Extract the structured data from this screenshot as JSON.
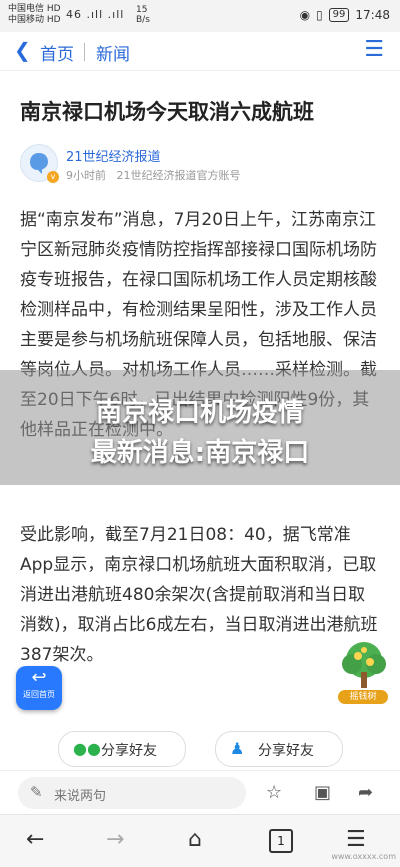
{
  "status_bar": {
    "carrier1": "中国电信 HD",
    "carrier2": "中国移动 HD",
    "signal": "46 .ıll .ıll",
    "speed_value": "15",
    "speed_unit": "B/s",
    "battery": "99",
    "time": "17:48"
  },
  "nav": {
    "home_label": "首页",
    "section_label": "新闻"
  },
  "article": {
    "title": "南京禄口机场今天取消六成航班",
    "source": "21世纪经济报道",
    "time_ago": "9小时前",
    "account": "21世纪经济报道官方账号",
    "paragraphs": [
      "据“南京发布”消息，7月20日上午，江苏南京江宁区新冠肺炎疫情防控指挥部接禄口国际机场防疫专班报告，在禄口国际机场工作人员定期核酸检测样品中，有检测结果呈阳性，涉及工作人员主要是参与机场航班保障人员，包括地服、保洁等岗位人员。对机场工作人员……采样检测。截至20日下午6时，已出结果中检测阳性9份，其他样品正在检测中。",
      "受此影响，截至7月21日08：40，据飞常准App显示，南京禄口机场航班大面积取消，已取消进出港航班480余架次(含提前取消和当日取消数)，取消占比6成左右，当日取消进出港航班387架次。"
    ]
  },
  "banner": {
    "line1": "南京禄口机场疫情",
    "line2": "最新消息:南京禄口"
  },
  "floating": {
    "return_label": "返回首页",
    "tree_label": "摇钱树"
  },
  "share": {
    "wechat": "分享好友",
    "qq": "分享好友"
  },
  "comment": {
    "placeholder": "来说两句"
  },
  "system_nav": {
    "tab_count": "1"
  },
  "watermark": "www.oxxxx.com",
  "colors": {
    "accent": "#2b6ad9",
    "return_button": "#2979ff",
    "tree_badge": "#e8a21a"
  }
}
